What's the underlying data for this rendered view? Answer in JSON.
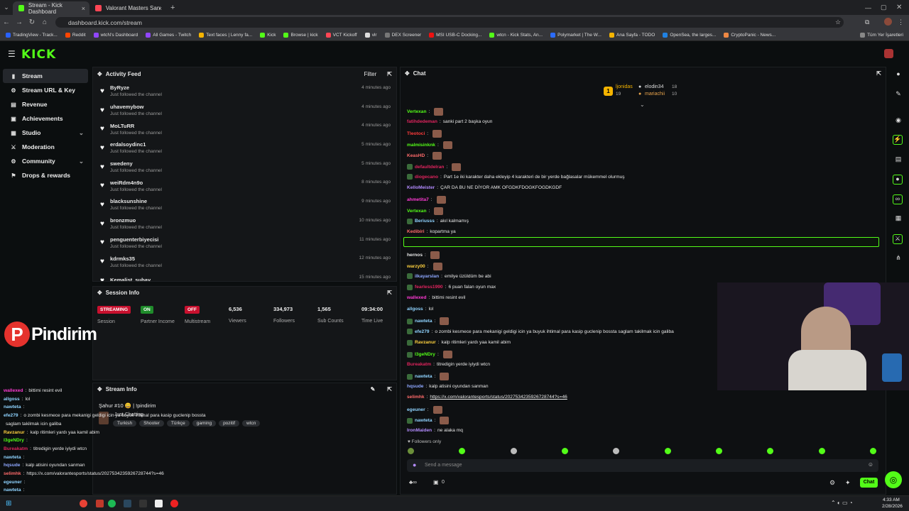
{
  "browser": {
    "tabs": [
      {
        "label": "Stream - Kick Dashboard",
        "color": "#53fc18"
      },
      {
        "label": "Valorant Masters Santiago 2026",
        "color": "#ff4655"
      }
    ],
    "url": "dashboard.kick.com/stream",
    "bookmarks": [
      "TradingView - Track...",
      "Reddit",
      "wtcN's Dashboard",
      "All Games - Twitch",
      "Text faces | Lenny fa...",
      "Kick",
      "Browse | kick",
      "VCT Kickoff",
      "vlr",
      "DEX Screener",
      "MSI USB-C Docking...",
      "wtcn - Kick Stats, An...",
      "Polymarket | The W...",
      "Ana Sayfa - TODO",
      "OpenSea, the larges...",
      "CryptoPanic - News...",
      "Tüm Yer İşaretleri"
    ]
  },
  "brand": {
    "logo": "KICK",
    "accent": "#53fc18"
  },
  "sidebar": {
    "items": [
      {
        "label": "Stream",
        "icon": "stream-icon"
      },
      {
        "label": "Stream URL & Key",
        "icon": "key-icon"
      },
      {
        "label": "Revenue",
        "icon": "revenue-icon"
      },
      {
        "label": "Achievements",
        "icon": "trophy-icon"
      },
      {
        "label": "Studio",
        "icon": "studio-icon"
      },
      {
        "label": "Moderation",
        "icon": "sword-icon"
      },
      {
        "label": "Community",
        "icon": "gear-icon"
      },
      {
        "label": "Drops & rewards",
        "icon": "gift-icon"
      }
    ]
  },
  "activity": {
    "title": "Activity Feed",
    "filter": "Filter",
    "items": [
      {
        "name": "ByRyze",
        "action": "Just followed the channel",
        "time": "4 minutes ago"
      },
      {
        "name": "uhavemybow",
        "action": "Just followed the channel",
        "time": "4 minutes ago"
      },
      {
        "name": "MoLTuRR",
        "action": "Just followed the channel",
        "time": "4 minutes ago"
      },
      {
        "name": "erdalsoydinc1",
        "action": "Just followed the channel",
        "time": "5 minutes ago"
      },
      {
        "name": "swedeny",
        "action": "Just followed the channel",
        "time": "5 minutes ago"
      },
      {
        "name": "weiRdm4n9o",
        "action": "Just followed the channel",
        "time": "8 minutes ago"
      },
      {
        "name": "blacksunshine",
        "action": "Just followed the channel",
        "time": "9 minutes ago"
      },
      {
        "name": "bronzmuo",
        "action": "Just followed the channel",
        "time": "10 minutes ago"
      },
      {
        "name": "penguenterbiyecisi",
        "action": "Just followed the channel",
        "time": "11 minutes ago"
      },
      {
        "name": "kdrmks35",
        "action": "Just followed the channel",
        "time": "12 minutes ago"
      },
      {
        "name": "Kemalist_subay",
        "action": "",
        "time": "15 minutes ago"
      }
    ]
  },
  "session": {
    "title": "Session Info",
    "session_badge": "STREAMING",
    "session_label": "Session",
    "partner_badge": "ON",
    "partner_label": "Partner Income",
    "multistream_badge": "OFF",
    "multistream_label": "Multistream",
    "viewers": "6,536",
    "viewers_label": "Viewers",
    "followers": "334,973",
    "followers_label": "Followers",
    "subs": "1,565",
    "subs_label": "Sub Counts",
    "time": "09:34:00",
    "time_label": "Time Live"
  },
  "stream_info": {
    "title": "Stream Info",
    "stream_title": "Şahur #10 😄 | !pindirim",
    "category": "Just Chatting",
    "tags": [
      "Turkish",
      "Shooter",
      "Türkçe",
      "gaming",
      "pozitif",
      "wtcn"
    ]
  },
  "overlay": {
    "brand": "Pindirim"
  },
  "chat": {
    "title": "Chat",
    "top_gifters": [
      {
        "name": "ljonidas",
        "count": "19"
      },
      {
        "name": "elodin34",
        "count": "18"
      },
      {
        "name": "mariachii",
        "count": "10"
      }
    ],
    "messages": [
      {
        "user": "Vertexan",
        "color": "#53fc18",
        "text": ""
      },
      {
        "user": "fatihdedeman",
        "color": "#e0245e",
        "text": "sanki part 2 başka oyun"
      },
      {
        "user": "Tleotoci",
        "color": "#ff3b3b",
        "text": ""
      },
      {
        "user": "malmisinknk",
        "color": "#53fc18",
        "text": ""
      },
      {
        "user": "KeasHD",
        "color": "#ff6b6b",
        "text": ""
      },
      {
        "user": "defaultdelran",
        "color": "#e0245e",
        "text": ""
      },
      {
        "user": "diogecano",
        "color": "#e0245e",
        "text": "Part 1e iki karakter daha ekleyip 4 karakteri de bir yerde bağlasalar mükemmel olurmuş"
      },
      {
        "user": "KelloMeister",
        "color": "#b38cff",
        "text": "ÇAR DA BU NE DİYOR AMK OFGDKFDOGKFOGDKGDF"
      },
      {
        "user": "ahmetita7",
        "color": "#ff3bd4",
        "text": ""
      },
      {
        "user": "Vertexan",
        "color": "#53fc18",
        "text": ""
      },
      {
        "user": "Beriusss",
        "color": "#8fd3ff",
        "text": "akıl kalmamış"
      },
      {
        "user": "Kedibiri",
        "color": "#ff6b6b",
        "text": "kopartma ya"
      },
      {
        "user": "PUNISHERXW",
        "color": "#ffd23f",
        "text": "@wtcn firidim part 1 part 2 aynı launcher da mı"
      },
      {
        "user": "hernos",
        "color": "#e8e8e8",
        "text": ""
      },
      {
        "user": "warzy00",
        "color": "#ffd23f",
        "text": ""
      },
      {
        "user": "ilkayarslan",
        "color": "#8fa8ff",
        "text": "emilye üzüldüm be abi"
      },
      {
        "user": "fearless1990",
        "color": "#e0245e",
        "text": "6 puan falan oyun max"
      },
      {
        "user": "wallexed",
        "color": "#ff3bd4",
        "text": "bittimi resint evil"
      },
      {
        "user": "allgoss",
        "color": "#8fd3ff",
        "text": "lol"
      },
      {
        "user": "nawteta",
        "color": "#8fd3ff",
        "text": ""
      },
      {
        "user": "efe279",
        "color": "#8fd3ff",
        "text": "o zombi kesmece para mekanigi geldigi icin ya buyuk ihtimal para kasip guclenip bossta saglam takilmak icin galiba"
      },
      {
        "user": "Ravzanur",
        "color": "#ffd23f",
        "text": "kalp ritimleri yardı yaa kamil abim"
      },
      {
        "user": "I3geNDry",
        "color": "#53fc18",
        "text": ""
      },
      {
        "user": "Bureakatm",
        "color": "#e0245e",
        "text": "titredigin yerde iyiydi wtcn"
      },
      {
        "user": "nawteta",
        "color": "#8fd3ff",
        "text": ""
      },
      {
        "user": "hqsude",
        "color": "#8fa8ff",
        "text": "kalp atisini oyundan sanman"
      },
      {
        "user": "selimhk",
        "color": "#ff6b6b",
        "text": "https://x.com/valorantesports/status/2027534235926728744?s=46"
      },
      {
        "user": "egeuner",
        "color": "#8fd3ff",
        "text": ""
      },
      {
        "user": "nawteta",
        "color": "#8fd3ff",
        "text": ""
      },
      {
        "user": "IronMaiden",
        "color": "#b38cff",
        "text": "ne alaka mq"
      }
    ],
    "followers_only": "Followers only",
    "input_placeholder": "Send a message",
    "send_label": "Chat",
    "points": "0"
  },
  "overlay_chat": [
    {
      "user": "wallexed",
      "color": "#ff3bd4",
      "text": "bittimi resint evil"
    },
    {
      "user": "allgoss",
      "color": "#8fd3ff",
      "text": "lol"
    },
    {
      "user": "nawteta",
      "color": "#8fd3ff",
      "text": ""
    },
    {
      "user": "efe279",
      "color": "#8fd3ff",
      "text": "o zombi kesmece para mekanigi geldigi icin ya buyuk ihtimal para kasip guclenip bossta"
    },
    {
      "user": "",
      "color": "#e8e8e8",
      "text": "saglam takilmak icin galiba"
    },
    {
      "user": "Ravzanur",
      "color": "#ffd23f",
      "text": "kalp ritimleri yardı yaa kamil abim"
    },
    {
      "user": "I3geNDry",
      "color": "#53fc18",
      "text": ""
    },
    {
      "user": "Bureakatm",
      "color": "#e0245e",
      "text": "titredigin yerde iyiydi wtcn"
    },
    {
      "user": "nawteta",
      "color": "#8fd3ff",
      "text": ""
    },
    {
      "user": "hqsude",
      "color": "#8fa8ff",
      "text": "kalp atisini oyundan sanman"
    },
    {
      "user": "selimhk",
      "color": "#ff6b6b",
      "text": "https://x.com/valorantesports/status/2027534235926728744?s=46"
    },
    {
      "user": "egeuner",
      "color": "#8fd3ff",
      "text": ""
    },
    {
      "user": "nawteta",
      "color": "#8fd3ff",
      "text": ""
    },
    {
      "user": "IronMaiden",
      "color": "#b38cff",
      "text": "ne alaka mq"
    }
  ],
  "taskbar": {
    "time": "4:33 AM",
    "date": "2/28/2026"
  }
}
